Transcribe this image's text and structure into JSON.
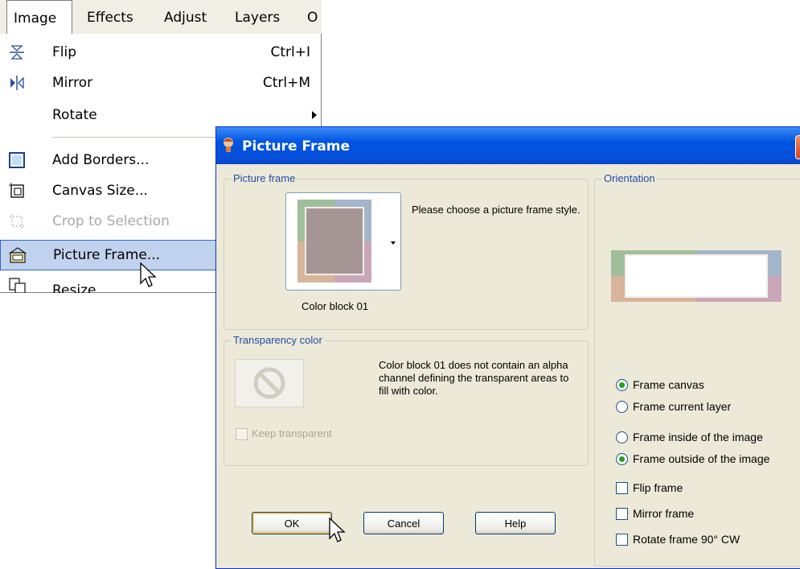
{
  "menubar": {
    "items": [
      {
        "label": "Image"
      },
      {
        "label": "Effects"
      },
      {
        "label": "Adjust"
      },
      {
        "label": "Layers"
      },
      {
        "label": "O"
      }
    ]
  },
  "image_menu": {
    "items": [
      {
        "label": "Flip",
        "shortcut": "Ctrl+I",
        "icon": "flip-icon"
      },
      {
        "label": "Mirror",
        "shortcut": "Ctrl+M",
        "icon": "mirror-icon"
      },
      {
        "label": "Rotate",
        "shortcut": "",
        "icon": "",
        "submenu": true
      },
      {
        "label": "Add Borders...",
        "shortcut": "",
        "icon": "add-borders-icon"
      },
      {
        "label": "Canvas Size...",
        "shortcut": "",
        "icon": "canvas-size-icon"
      },
      {
        "label": "Crop to Selection",
        "shortcut": "",
        "icon": "crop-icon",
        "disabled": true
      },
      {
        "label": "Picture Frame...",
        "shortcut": "",
        "icon": "picture-frame-icon",
        "highlighted": true
      },
      {
        "label": "Resize",
        "shortcut": "",
        "icon": "resize-icon"
      }
    ]
  },
  "dialog": {
    "title": "Picture Frame",
    "close": "X",
    "picture_frame_group": {
      "label": "Picture frame",
      "description": "Please choose a picture frame style.",
      "selected_style": "Color block 01"
    },
    "transparency_group": {
      "label": "Transparency color",
      "message": "Color block 01 does not contain an alpha channel defining the transparent areas to fill with color.",
      "keep_transparent": "Keep transparent"
    },
    "orientation_group": {
      "label": "Orientation"
    },
    "options": {
      "frame_canvas": "Frame canvas",
      "frame_current_layer": "Frame current layer",
      "frame_inside": "Frame inside of the image",
      "frame_outside": "Frame outside of the image",
      "flip_frame": "Flip frame",
      "mirror_frame": "Mirror frame",
      "rotate_frame": "Rotate frame 90° CW"
    },
    "buttons": {
      "ok": "OK",
      "cancel": "Cancel",
      "help": "Help"
    }
  },
  "colors": {
    "dialog_bg": "#ece9d8",
    "titlebar": "#0054e3",
    "menu_highlight": "#c1d2ee",
    "group_label": "#1f4fa8"
  }
}
